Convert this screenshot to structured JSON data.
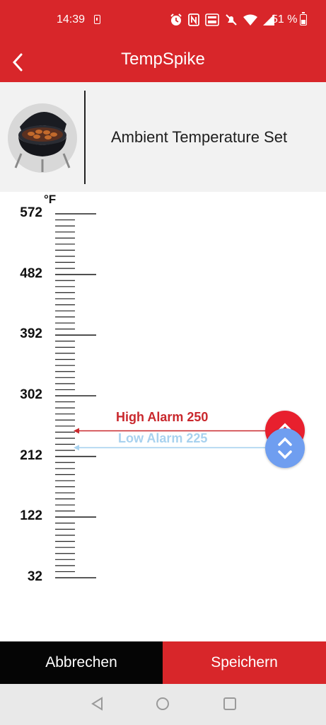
{
  "status_bar": {
    "time": "14:39",
    "battery_percent": "51 %",
    "icons": [
      "sim-icon",
      "alarm-clock-icon",
      "nfc-icon",
      "volte-icon",
      "mute-icon",
      "wifi-icon",
      "signal-icon",
      "battery-icon"
    ]
  },
  "app_bar": {
    "title": "TempSpike",
    "back_icon": "chevron-left-icon"
  },
  "header": {
    "image": "grill-image",
    "title": "Ambient Temperature Set"
  },
  "scale": {
    "unit": "°F",
    "major_labels": [
      "572",
      "482",
      "392",
      "302",
      "212",
      "122",
      "32"
    ],
    "min": 32,
    "max": 572
  },
  "alarms": {
    "high": {
      "label": "High Alarm 250",
      "value": 250,
      "color": "#c9282d"
    },
    "low": {
      "label": "Low Alarm 225",
      "value": 225,
      "color": "#a8d2ef"
    }
  },
  "buttons": {
    "cancel": "Abbrechen",
    "save": "Speichern"
  },
  "colors": {
    "brand_red": "#d8262a",
    "handle_red": "#e8202e",
    "handle_blue": "#6f9ef0"
  },
  "nav_bar": [
    "back-triangle-icon",
    "home-circle-icon",
    "recents-square-icon"
  ]
}
